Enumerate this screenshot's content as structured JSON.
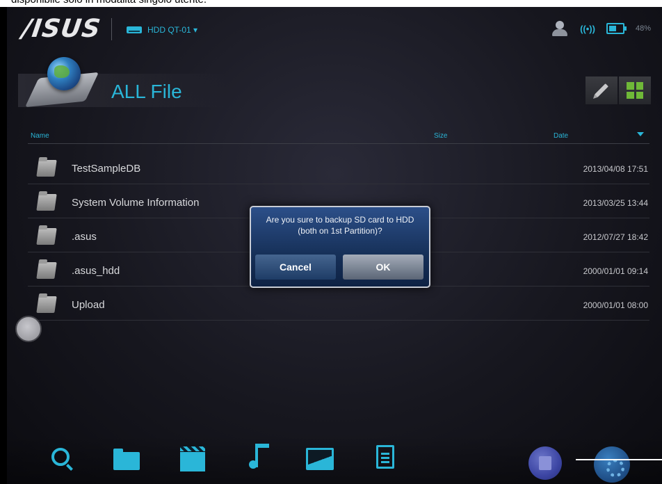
{
  "caption": "disponibile solo in modalità singolo utente.",
  "topbar": {
    "brand": "/ISUS",
    "device_name": "HDD QT-01 ▾",
    "battery_percent": "48%",
    "icons": [
      "user-icon",
      "wifi-icon",
      "battery-icon"
    ]
  },
  "header": {
    "title": "ALL File",
    "tools": [
      "pencil-icon",
      "grid-view-icon"
    ]
  },
  "columns": {
    "name": "Name",
    "size": "Size",
    "date": "Date"
  },
  "files": [
    {
      "name": "TestSampleDB",
      "date": "2013/04/08 17:51"
    },
    {
      "name": "System Volume Information",
      "date": "2013/03/25 13:44"
    },
    {
      "name": ".asus",
      "date": "2012/07/27 18:42"
    },
    {
      "name": ".asus_hdd",
      "date": "2000/01/01 09:14"
    },
    {
      "name": "Upload",
      "date": "2000/01/01 08:00"
    }
  ],
  "dialog": {
    "message": "Are you sure to backup SD card to HDD (both on 1st Partition)?",
    "cancel_label": "Cancel",
    "ok_label": "OK"
  },
  "bottom_nav": [
    "search-icon",
    "folder-icon",
    "video-icon",
    "music-icon",
    "picture-icon",
    "document-icon",
    "backup-icon",
    "settings-icon"
  ],
  "colors": {
    "accent": "#2ab6d8",
    "dialog": "#1c3a6e",
    "grid_green": "#6fb838"
  }
}
